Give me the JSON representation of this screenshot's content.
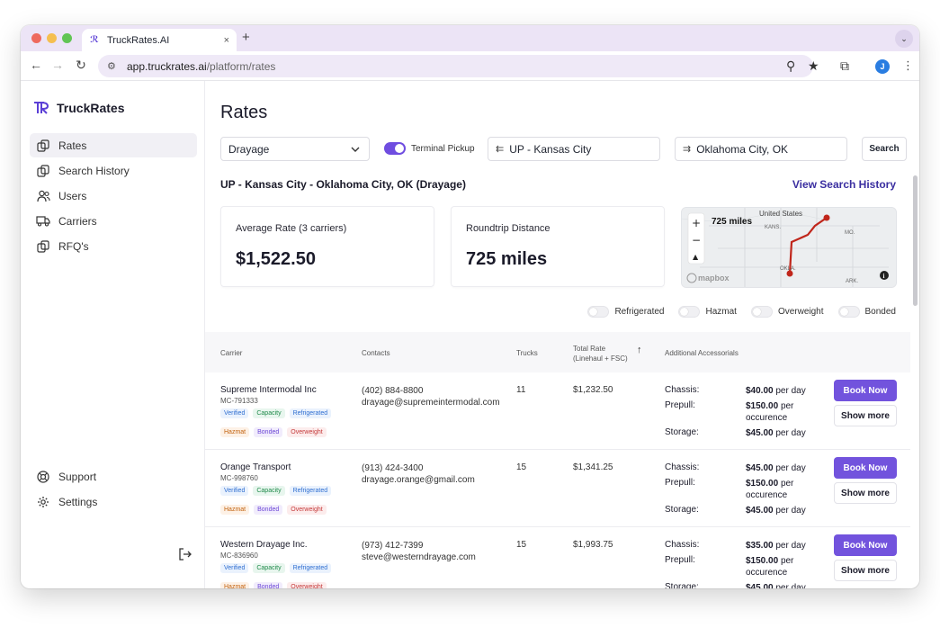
{
  "browser": {
    "tab_title": "TruckRates.AI",
    "tab_close": "×",
    "new_tab": "+",
    "url_host": "app.truckrates.ai",
    "url_path": "/platform/rates",
    "profile_initial": "J"
  },
  "colors": {
    "accent": "#7253dd",
    "brand": "#5b3fd6",
    "route": "#c0261b"
  },
  "sidebar": {
    "brand": "TruckRates",
    "items": [
      {
        "label": "Rates",
        "icon": "rates-icon",
        "active": true
      },
      {
        "label": "Search History",
        "icon": "history-icon"
      },
      {
        "label": "Users",
        "icon": "users-icon"
      },
      {
        "label": "Carriers",
        "icon": "truck-icon"
      },
      {
        "label": "RFQ's",
        "icon": "rfq-icon"
      }
    ],
    "bottom": [
      {
        "label": "Support",
        "icon": "support-icon"
      },
      {
        "label": "Settings",
        "icon": "gear-icon"
      }
    ]
  },
  "main": {
    "title": "Rates",
    "mode_select": "Drayage",
    "terminal_pickup_label": "Terminal Pickup",
    "origin": "UP - Kansas City",
    "destination": "Oklahoma City, OK",
    "search_label": "Search",
    "route_title": "UP - Kansas City - Oklahoma City, OK (Drayage)",
    "view_history": "View Search History",
    "avg_rate_label": "Average Rate (3 carriers)",
    "avg_rate_value": "$1,522.50",
    "distance_label": "Roundtrip Distance",
    "distance_value": "725 miles"
  },
  "map": {
    "distance": "725 miles",
    "country": "United States",
    "state_a": "KANS.",
    "state_b": "OKLA.",
    "state_c": "MO.",
    "state_d": "ARK.",
    "zoom_in": "+",
    "zoom_out": "−",
    "compass": "▲",
    "attribution": "mapbox",
    "info": "i"
  },
  "filters": [
    "Refrigerated",
    "Hazmat",
    "Overweight",
    "Bonded"
  ],
  "table": {
    "headers": {
      "carrier": "Carrier",
      "contacts": "Contacts",
      "trucks": "Trucks",
      "total_rate_1": "Total Rate",
      "total_rate_2": "(Linehaul + FSC)",
      "accessorials": "Additional Accessorials",
      "sort_icon": "↑"
    },
    "book_label": "Book Now",
    "more_label": "Show more",
    "rows": [
      {
        "name": "Supreme Intermodal Inc",
        "mc": "MC-791333",
        "phone": "(402) 884-8800",
        "email": "drayage@supremeintermodal.com",
        "trucks": "11",
        "total": "$1,232.50",
        "chassis": "$40.00",
        "prepull": "$150.00",
        "storage": "$45.00"
      },
      {
        "name": "Orange Transport",
        "mc": "MC-998760",
        "phone": "(913) 424-3400",
        "email": "drayage.orange@gmail.com",
        "trucks": "15",
        "total": "$1,341.25",
        "chassis": "$45.00",
        "prepull": "$150.00",
        "storage": "$45.00"
      },
      {
        "name": "Western Drayage Inc.",
        "mc": "MC-836960",
        "phone": "(973) 412-7399",
        "email": "steve@westerndrayage.com",
        "trucks": "15",
        "total": "$1,993.75",
        "chassis": "$35.00",
        "prepull": "$150.00",
        "storage": "$45.00"
      }
    ],
    "badges_row1": [
      "Verified",
      "Capacity",
      "Refrigerated"
    ],
    "badges_row2": [
      "Hazmat",
      "Bonded",
      "Overweight"
    ],
    "acc_labels": {
      "chassis": "Chassis:",
      "prepull": "Prepull:",
      "storage": "Storage:"
    },
    "acc_units": {
      "per_day": "per day",
      "per": "per",
      "occurence": "occurence"
    }
  }
}
